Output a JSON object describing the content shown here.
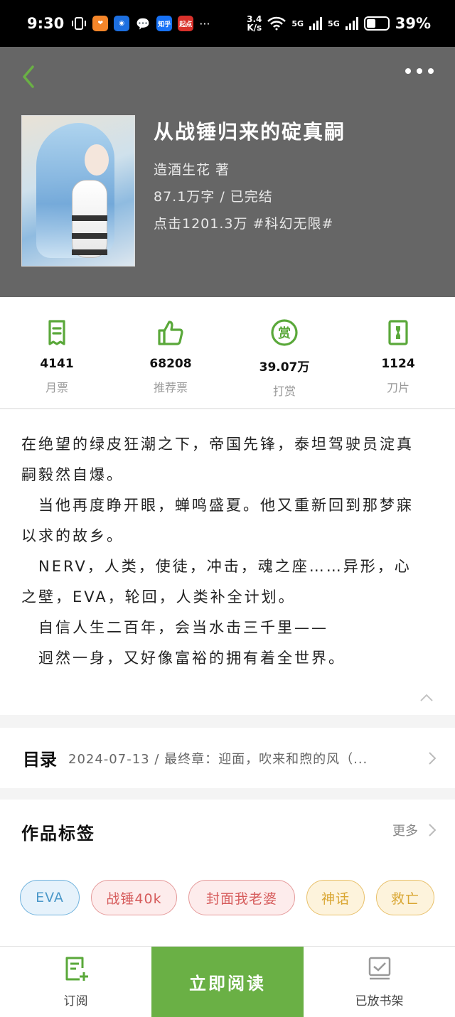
{
  "status_bar": {
    "time": "9:30",
    "net_speed": "3.4\nK/s",
    "net_speed_top": "3.4",
    "net_speed_bottom": "K/s",
    "sim1": "5G",
    "sim2": "5G",
    "battery": "39%",
    "app_zhihu": "知乎",
    "app_qidian": "起点",
    "more": "···"
  },
  "book": {
    "title": "从战锤归来的碇真嗣",
    "author_line": "造酒生花 著",
    "words_status": "87.1万字 / 已完结",
    "clicks_genre": "点击1201.3万 #科幻无限#"
  },
  "stats": [
    {
      "value": "4141",
      "label": "月票",
      "icon": "ticket-icon"
    },
    {
      "value": "68208",
      "label": "推荐票",
      "icon": "thumbs-up-icon"
    },
    {
      "value": "39.07万",
      "label": "打赏",
      "icon": "reward-icon"
    },
    {
      "value": "1124",
      "label": "刀片",
      "icon": "blade-icon"
    }
  ],
  "synopsis": [
    "在绝望的绿皮狂潮之下，帝国先锋，泰坦驾驶员淀真",
    "嗣毅然自爆。",
    "　当他再度睁开眼，蝉鸣盛夏。他又重新回到那梦寐",
    "以求的故乡。",
    "　NERV，人类，使徒，冲击，魂之座……异形，心",
    "之壁，EVA，轮回，人类补全计划。",
    "　自信人生二百年，会当水击三千里——",
    "　迥然一身，又好像富裕的拥有着全世界。"
  ],
  "toc": {
    "title": "目录",
    "latest": "2024-07-13 / 最终章：迎面，吹来和煦的风（..."
  },
  "tags": {
    "title": "作品标签",
    "more": "更多",
    "items": [
      "EVA",
      "战锤40k",
      "封面我老婆",
      "神话",
      "救亡"
    ]
  },
  "bottom_bar": {
    "subscribe": "订阅",
    "read_now": "立即阅读",
    "on_shelf": "已放书架"
  },
  "colors": {
    "header_bg": "#666666",
    "accent_green": "#6ab045",
    "icon_green": "#5aa83a"
  }
}
